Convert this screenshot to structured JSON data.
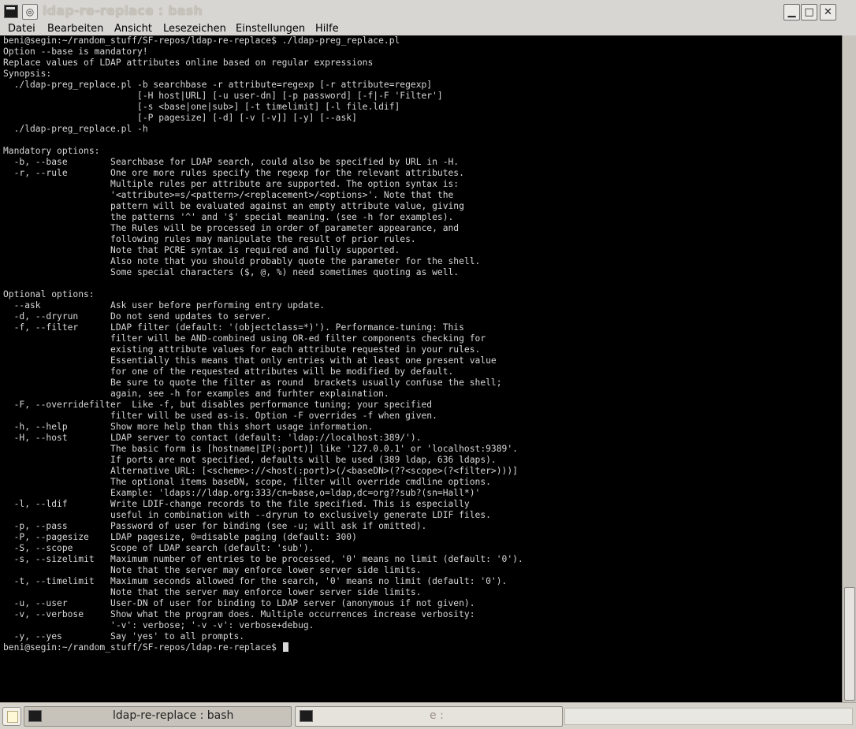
{
  "window": {
    "title": "ldap-re-replace : bash",
    "sticky_glyph": "◎",
    "btn_minimize": "▁",
    "btn_maximize": "□",
    "btn_close": "✕"
  },
  "menu": [
    "Datei",
    "Bearbeiten",
    "Ansicht",
    "Lesezeichen",
    "Einstellungen",
    "Hilfe"
  ],
  "terminal": {
    "lines": [
      "beni@segin:~/random_stuff/SF-repos/ldap-re-replace$ ./ldap-preg_replace.pl",
      "Option --base is mandatory!",
      "Replace values of LDAP attributes online based on regular expressions",
      "Synopsis:",
      "  ./ldap-preg_replace.pl -b searchbase -r attribute=regexp [-r attribute=regexp]",
      "                         [-H host|URL] [-u user-dn] [-p password] [-f|-F 'Filter']",
      "                         [-s <base|one|sub>] [-t timelimit] [-l file.ldif]",
      "                         [-P pagesize] [-d] [-v [-v]] [-y] [--ask]",
      "  ./ldap-preg_replace.pl -h",
      "",
      "Mandatory options:",
      "  -b, --base        Searchbase for LDAP search, could also be specified by URL in -H.",
      "  -r, --rule        One ore more rules specify the regexp for the relevant attributes.",
      "                    Multiple rules per attribute are supported. The option syntax is:",
      "                    '<attribute>=s/<pattern>/<replacement>/<options>'. Note that the",
      "                    pattern will be evaluated against an empty attribute value, giving",
      "                    the patterns '^' and '$' special meaning. (see -h for examples).",
      "                    The Rules will be processed in order of parameter appearance, and",
      "                    following rules may manipulate the result of prior rules.",
      "                    Note that PCRE syntax is required and fully supported.",
      "                    Also note that you should probably quote the parameter for the shell.",
      "                    Some special characters ($, @, %) need sometimes quoting as well.",
      "",
      "Optional options:",
      "  --ask             Ask user before performing entry update.",
      "  -d, --dryrun      Do not send updates to server.",
      "  -f, --filter      LDAP filter (default: '(objectclass=*)'). Performance-tuning: This",
      "                    filter will be AND-combined using OR-ed filter components checking for",
      "                    existing attribute values for each attribute requested in your rules.",
      "                    Essentially this means that only entries with at least one present value",
      "                    for one of the requested attributes will be modified by default.",
      "                    Be sure to quote the filter as round  brackets usually confuse the shell;",
      "                    again, see -h for examples and furhter explaination.",
      "  -F, --overridefilter  Like -f, but disables performance tuning; your specified",
      "                    filter will be used as-is. Option -F overrides -f when given.",
      "  -h, --help        Show more help than this short usage information.",
      "  -H, --host        LDAP server to contact (default: 'ldap://localhost:389/').",
      "                    The basic form is [hostname|IP(:port)] like '127.0.0.1' or 'localhost:9389'.",
      "                    If ports are not specified, defaults will be used (389 ldap, 636 ldaps).",
      "                    Alternative URL: [<scheme>://<host(:port)>(/<baseDN>(??<scope>(?<filter>)))]",
      "                    The optional items baseDN, scope, filter will override cmdline options.",
      "                    Example: 'ldaps://ldap.org:333/cn=base,o=ldap,dc=org??sub?(sn=Hall*)'",
      "  -l, --ldif        Write LDIF-change records to the file specified. This is especially",
      "                    useful in combination with --dryrun to exclusively generate LDIF files.",
      "  -p, --pass        Password of user for binding (see -u; will ask if omitted).",
      "  -P, --pagesize    LDAP pagesize, 0=disable paging (default: 300)",
      "  -S, --scope       Scope of LDAP search (default: 'sub').",
      "  -s, --sizelimit   Maximum number of entries to be processed, '0' means no limit (default: '0').",
      "                    Note that the server may enforce lower server side limits.",
      "  -t, --timelimit   Maximum seconds allowed for the search, '0' means no limit (default: '0').",
      "                    Note that the server may enforce lower server side limits.",
      "  -u, --user        User-DN of user for binding to LDAP server (anonymous if not given).",
      "  -v, --verbose     Show what the program does. Multiple occurrences increase verbosity:",
      "                    '-v': verbose; '-v -v': verbose+debug.",
      "  -y, --yes         Say 'yes' to all prompts."
    ],
    "prompt": "beni@segin:~/random_stuff/SF-repos/ldap-re-replace$ "
  },
  "taskbar": {
    "tasks": [
      {
        "label": "ldap-re-replace : bash"
      },
      {
        "label": "e :"
      }
    ]
  }
}
